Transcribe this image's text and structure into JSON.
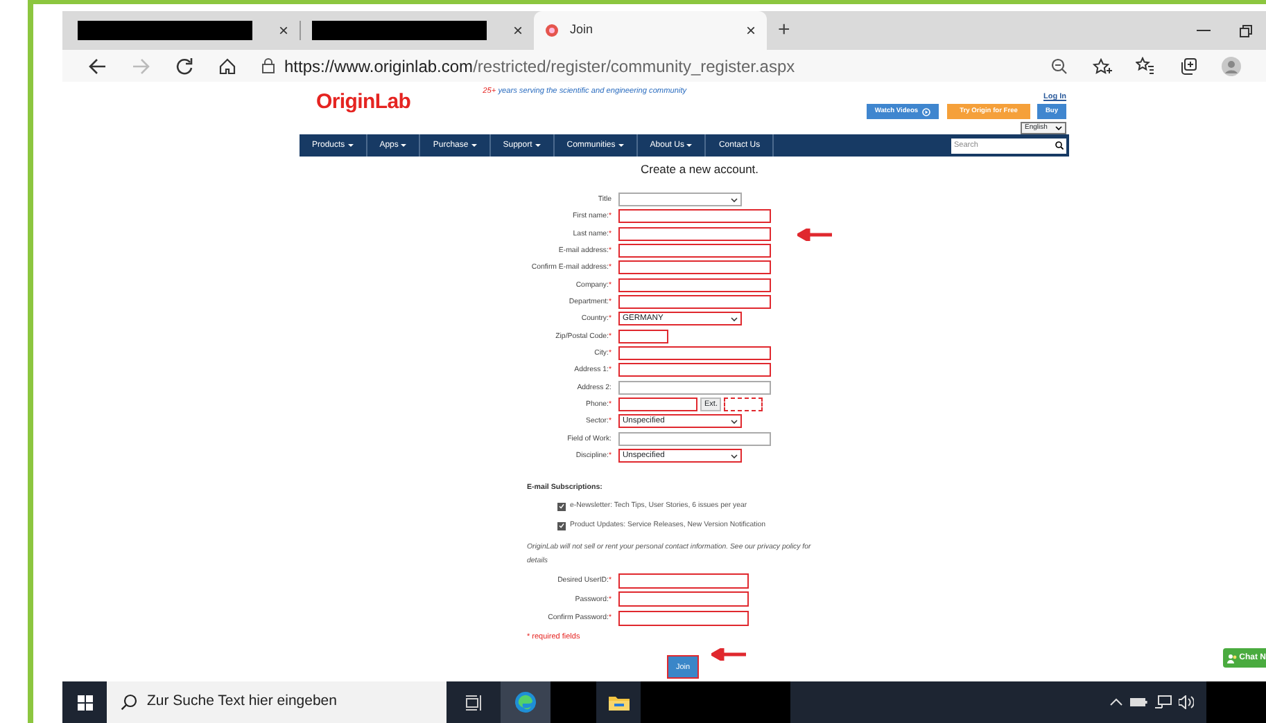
{
  "browser": {
    "tabs": [
      {
        "kind": "redacted",
        "selected": false,
        "close": "×"
      },
      {
        "kind": "redacted",
        "selected": false,
        "close": "×"
      },
      {
        "kind": "page",
        "title": "Join",
        "selected": true,
        "close": "×"
      }
    ],
    "new_tab": "+",
    "toolbar": {
      "forward_disabled": true,
      "url_host": "https://www.originlab.com",
      "url_path": "/restricted/register/community_register.aspx"
    }
  },
  "site": {
    "logo": "OriginLab",
    "tagline_lead": "25+",
    "tagline": "years serving the scientific and engineering community",
    "login": "Log In",
    "buttons": [
      {
        "label": "Watch Videos",
        "kind": "video"
      },
      {
        "label": "Try Origin for Free",
        "kind": "trial"
      },
      {
        "label": "Buy",
        "kind": "buy"
      }
    ],
    "language": "English",
    "nav": [
      {
        "label": "Products",
        "dropdown": true
      },
      {
        "label": "Apps",
        "dropdown": true
      },
      {
        "label": "Purchase",
        "dropdown": true
      },
      {
        "label": "Support",
        "dropdown": true
      },
      {
        "label": "Communities",
        "dropdown": true
      },
      {
        "label": "About Us",
        "dropdown": true
      },
      {
        "label": "Contact Us",
        "dropdown": false
      }
    ],
    "search_placeholder": "Search"
  },
  "form": {
    "heading": "Create a new account.",
    "fields": [
      {
        "label": "Title",
        "required": false,
        "kind": "select"
      },
      {
        "label": "First name:",
        "mark": "*",
        "required": true,
        "kind": "text"
      },
      {
        "label": "Last name:",
        "mark": "*",
        "required": true,
        "kind": "text"
      },
      {
        "label": "E-mail address:",
        "mark": "*",
        "required": true,
        "kind": "text"
      },
      {
        "label": "Confirm E-mail address:",
        "mark": "*",
        "required": true,
        "kind": "text"
      },
      {
        "label": "Company:",
        "mark": "*",
        "required": true,
        "kind": "text"
      },
      {
        "label": "Department:",
        "mark": "*",
        "required": true,
        "kind": "text"
      },
      {
        "label": "Country:",
        "mark": "*",
        "required": true,
        "kind": "select",
        "value": "GERMANY"
      },
      {
        "label": "Zip/Postal Code:",
        "mark": "*",
        "required": true,
        "kind": "short"
      },
      {
        "label": "City:",
        "mark": "*",
        "required": true,
        "kind": "text"
      },
      {
        "label": "Address 1:",
        "mark": "*",
        "required": true,
        "kind": "text"
      },
      {
        "label": "Address 2:",
        "required": false,
        "kind": "text"
      },
      {
        "label": "Phone:",
        "mark": "*",
        "required": true,
        "kind": "phone",
        "ext": "Ext."
      },
      {
        "label": "Sector:",
        "mark": "*",
        "required": true,
        "kind": "select",
        "value": "Unspecified"
      },
      {
        "label": "Field of Work:",
        "required": false,
        "kind": "text"
      },
      {
        "label": "Discipline:",
        "mark": "*",
        "required": true,
        "kind": "select",
        "value": "Unspecified"
      }
    ],
    "subscriptions_heading": "E-mail Subscriptions:",
    "subscriptions": [
      {
        "label": "e-Newsletter: Tech Tips, User Stories, 6 issues per year",
        "checked": true
      },
      {
        "label": "Product Updates: Service Releases, New Version Notification",
        "checked": true
      }
    ],
    "privacy_before": "OriginLab will not sell or rent your personal contact information. See our",
    "privacy_link": "privacy policy",
    "privacy_after": "for details",
    "account_fields": [
      {
        "label": "Desired UserID:",
        "mark": "*",
        "required": true
      },
      {
        "label": "Password:",
        "mark": "*",
        "required": true
      },
      {
        "label": "Confirm Password:",
        "mark": "*",
        "required": true
      }
    ],
    "required_note": "* required fields",
    "submit": "Join"
  },
  "chat": "Chat N",
  "taskbar": {
    "search_placeholder": "Zur Suche Text hier eingeben"
  }
}
